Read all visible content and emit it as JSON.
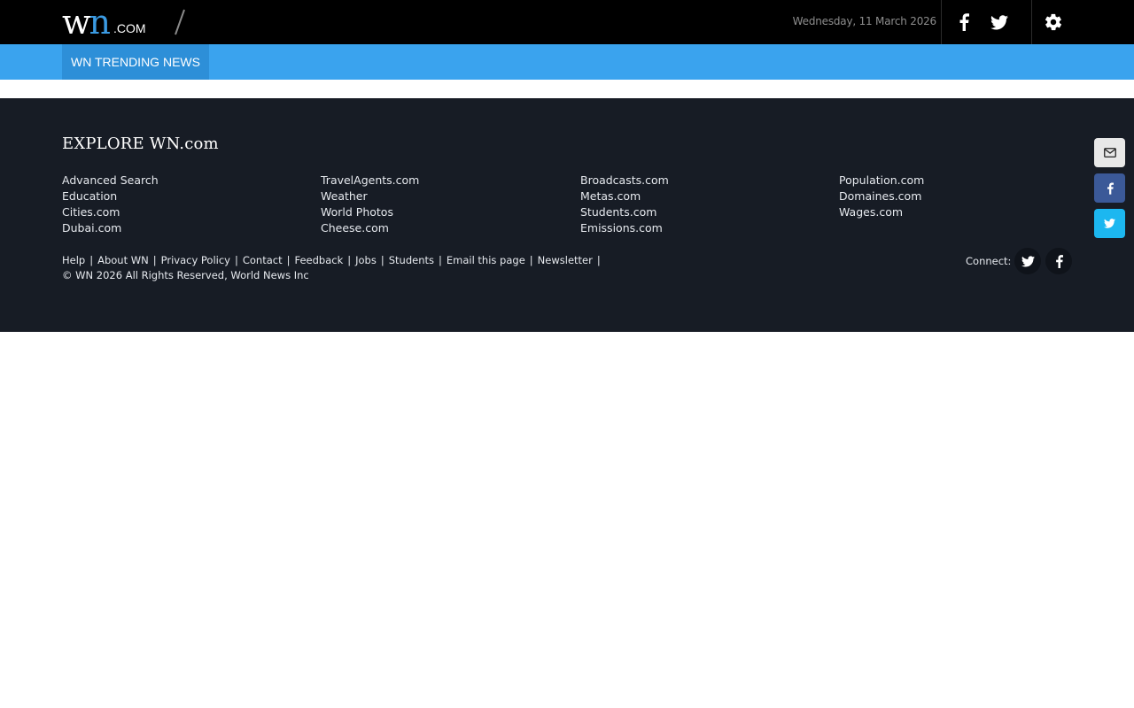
{
  "logo": {
    "w": "w",
    "n": "n",
    "com": ".COM"
  },
  "header": {
    "date": "Wednesday, 11 March 2026"
  },
  "nav": {
    "tab": "WN TRENDING NEWS"
  },
  "footer": {
    "heading": "EXPLORE WN.com",
    "columns": [
      [
        "Advanced Search",
        "Education",
        "Cities.com",
        "Dubai.com"
      ],
      [
        "TravelAgents.com",
        "Weather",
        "World Photos",
        "Cheese.com"
      ],
      [
        "Broadcasts.com",
        "Metas.com",
        "Students.com",
        "Emissions.com"
      ],
      [
        "Population.com",
        "Domaines.com",
        "Wages.com"
      ]
    ],
    "links": [
      "Help",
      "About WN",
      "Privacy Policy",
      "Contact",
      "Feedback",
      "Jobs",
      "Students",
      "Email this page",
      "Newsletter"
    ],
    "separator": "|",
    "copyright": "© WN 2026 All Rights Reserved, World News Inc",
    "connect_label": "Connect:"
  },
  "icons": {
    "facebook": "facebook-icon",
    "twitter": "twitter-icon",
    "gear": "gear-icon",
    "email": "email-icon"
  },
  "colors": {
    "topbar": "#000000",
    "nav": "#3aa3ee",
    "nav_active": "#2d8fd8",
    "footer": "#171c25",
    "float_email": "#e8e8e8",
    "float_facebook": "#3b5998",
    "float_twitter": "#1da1f2"
  }
}
